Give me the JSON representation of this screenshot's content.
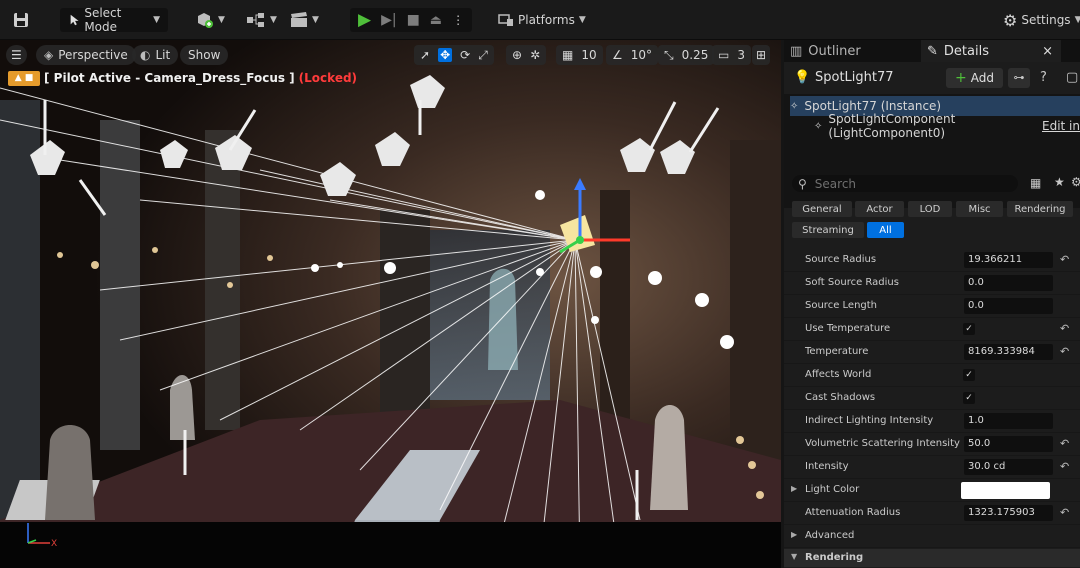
{
  "toolbar": {
    "select_mode": "Select Mode",
    "platforms": "Platforms",
    "settings": "Settings"
  },
  "viewport": {
    "perspective": "Perspective",
    "lit": "Lit",
    "show": "Show",
    "grid_snap": "10",
    "rotation_snap": "10°",
    "scale_snap": "0.25",
    "camera_speed": "3",
    "pilot_text": "[ Pilot Active - Camera_Dress_Focus ]",
    "locked_text": "(Locked)"
  },
  "panel": {
    "tabs": {
      "outliner": "Outliner",
      "details": "Details",
      "close": "×"
    },
    "actor_name": "SpotLight77",
    "add_label": "Add",
    "tree": [
      {
        "label": "SpotLight77 (Instance)"
      },
      {
        "label": "SpotLightComponent (LightComponent0)",
        "action": "Edit in"
      }
    ],
    "search_placeholder": "Search",
    "filters": [
      "General",
      "Actor",
      "LOD",
      "Misc",
      "Rendering",
      "Streaming",
      "All"
    ],
    "properties": [
      {
        "label": "Source Radius",
        "value": "19.366211",
        "reset": true
      },
      {
        "label": "Soft Source Radius",
        "value": "0.0"
      },
      {
        "label": "Source Length",
        "value": "0.0"
      },
      {
        "label": "Use Temperature",
        "check": true,
        "reset": true
      },
      {
        "label": "Temperature",
        "value": "8169.333984",
        "reset": true
      },
      {
        "label": "Affects World",
        "check": true
      },
      {
        "label": "Cast Shadows",
        "check": true
      },
      {
        "label": "Indirect Lighting Intensity",
        "value": "1.0"
      },
      {
        "label": "Volumetric Scattering Intensity",
        "value": "50.0",
        "reset": true
      },
      {
        "label": "Intensity",
        "value": "30.0 cd",
        "reset": true
      },
      {
        "label": "Light Color",
        "color": "#ffffff"
      },
      {
        "label": "Attenuation Radius",
        "value": "1323.175903",
        "reset": true
      },
      {
        "label": "Advanced"
      }
    ],
    "section_rendering": "Rendering"
  },
  "colors": {
    "accent": "#0070e0",
    "play": "#4fbf3a",
    "locked": "#ff3b3b",
    "camera_badge": "#e59b2c"
  }
}
